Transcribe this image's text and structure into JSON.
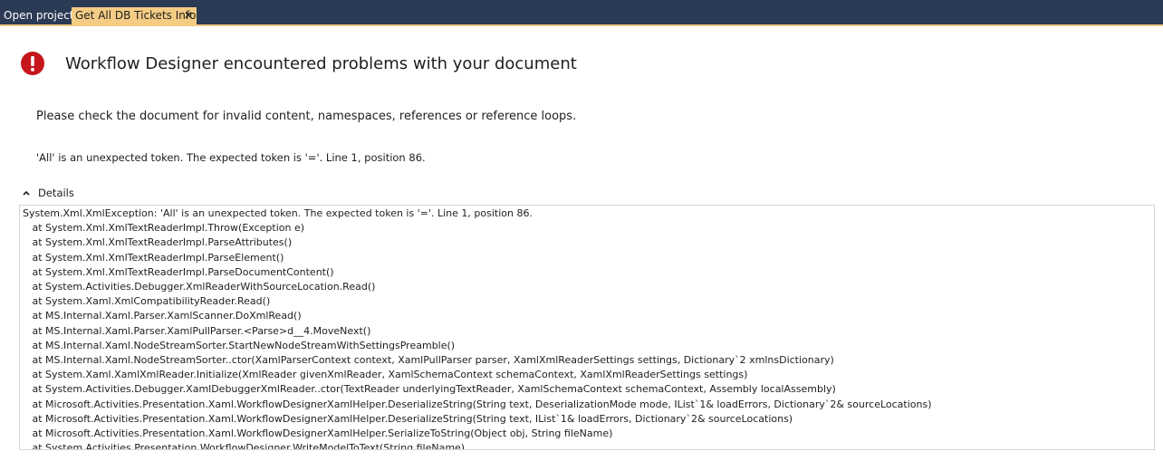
{
  "tabs": [
    {
      "label": "Open project"
    },
    {
      "label": "Get All DB Tickets Info",
      "close": "✕"
    }
  ],
  "header": {
    "title": "Workflow Designer encountered problems with your document",
    "icon": "error-icon",
    "icon_color": "#c5161c"
  },
  "subtitle": "Please check the document for invalid content, namespaces, references or reference loops.",
  "message": "'All' is an unexpected token. The expected token is '='. Line 1, position 86.",
  "details": {
    "label": "Details",
    "lines": [
      "System.Xml.XmlException: 'All' is an unexpected token. The expected token is '='. Line 1, position 86.",
      "   at System.Xml.XmlTextReaderImpl.Throw(Exception e)",
      "   at System.Xml.XmlTextReaderImpl.ParseAttributes()",
      "   at System.Xml.XmlTextReaderImpl.ParseElement()",
      "   at System.Xml.XmlTextReaderImpl.ParseDocumentContent()",
      "   at System.Activities.Debugger.XmlReaderWithSourceLocation.Read()",
      "   at System.Xaml.XmlCompatibilityReader.Read()",
      "   at MS.Internal.Xaml.Parser.XamlScanner.DoXmlRead()",
      "   at MS.Internal.Xaml.Parser.XamlPullParser.<Parse>d__4.MoveNext()",
      "   at MS.Internal.Xaml.NodeStreamSorter.StartNewNodeStreamWithSettingsPreamble()",
      "   at MS.Internal.Xaml.NodeStreamSorter..ctor(XamlParserContext context, XamlPullParser parser, XamlXmlReaderSettings settings, Dictionary`2 xmlnsDictionary)",
      "   at System.Xaml.XamlXmlReader.Initialize(XmlReader givenXmlReader, XamlSchemaContext schemaContext, XamlXmlReaderSettings settings)",
      "   at System.Activities.Debugger.XamlDebuggerXmlReader..ctor(TextReader underlyingTextReader, XamlSchemaContext schemaContext, Assembly localAssembly)",
      "   at Microsoft.Activities.Presentation.Xaml.WorkflowDesignerXamlHelper.DeserializeString(String text, DeserializationMode mode, IList`1& loadErrors, Dictionary`2& sourceLocations)",
      "   at Microsoft.Activities.Presentation.Xaml.WorkflowDesignerXamlHelper.DeserializeString(String text, IList`1& loadErrors, Dictionary`2& sourceLocations)",
      "   at Microsoft.Activities.Presentation.Xaml.WorkflowDesignerXamlHelper.SerializeToString(Object obj, String fileName)",
      "   at System.Activities.Presentation.WorkflowDesigner.WriteModelToText(String fileName)"
    ]
  }
}
